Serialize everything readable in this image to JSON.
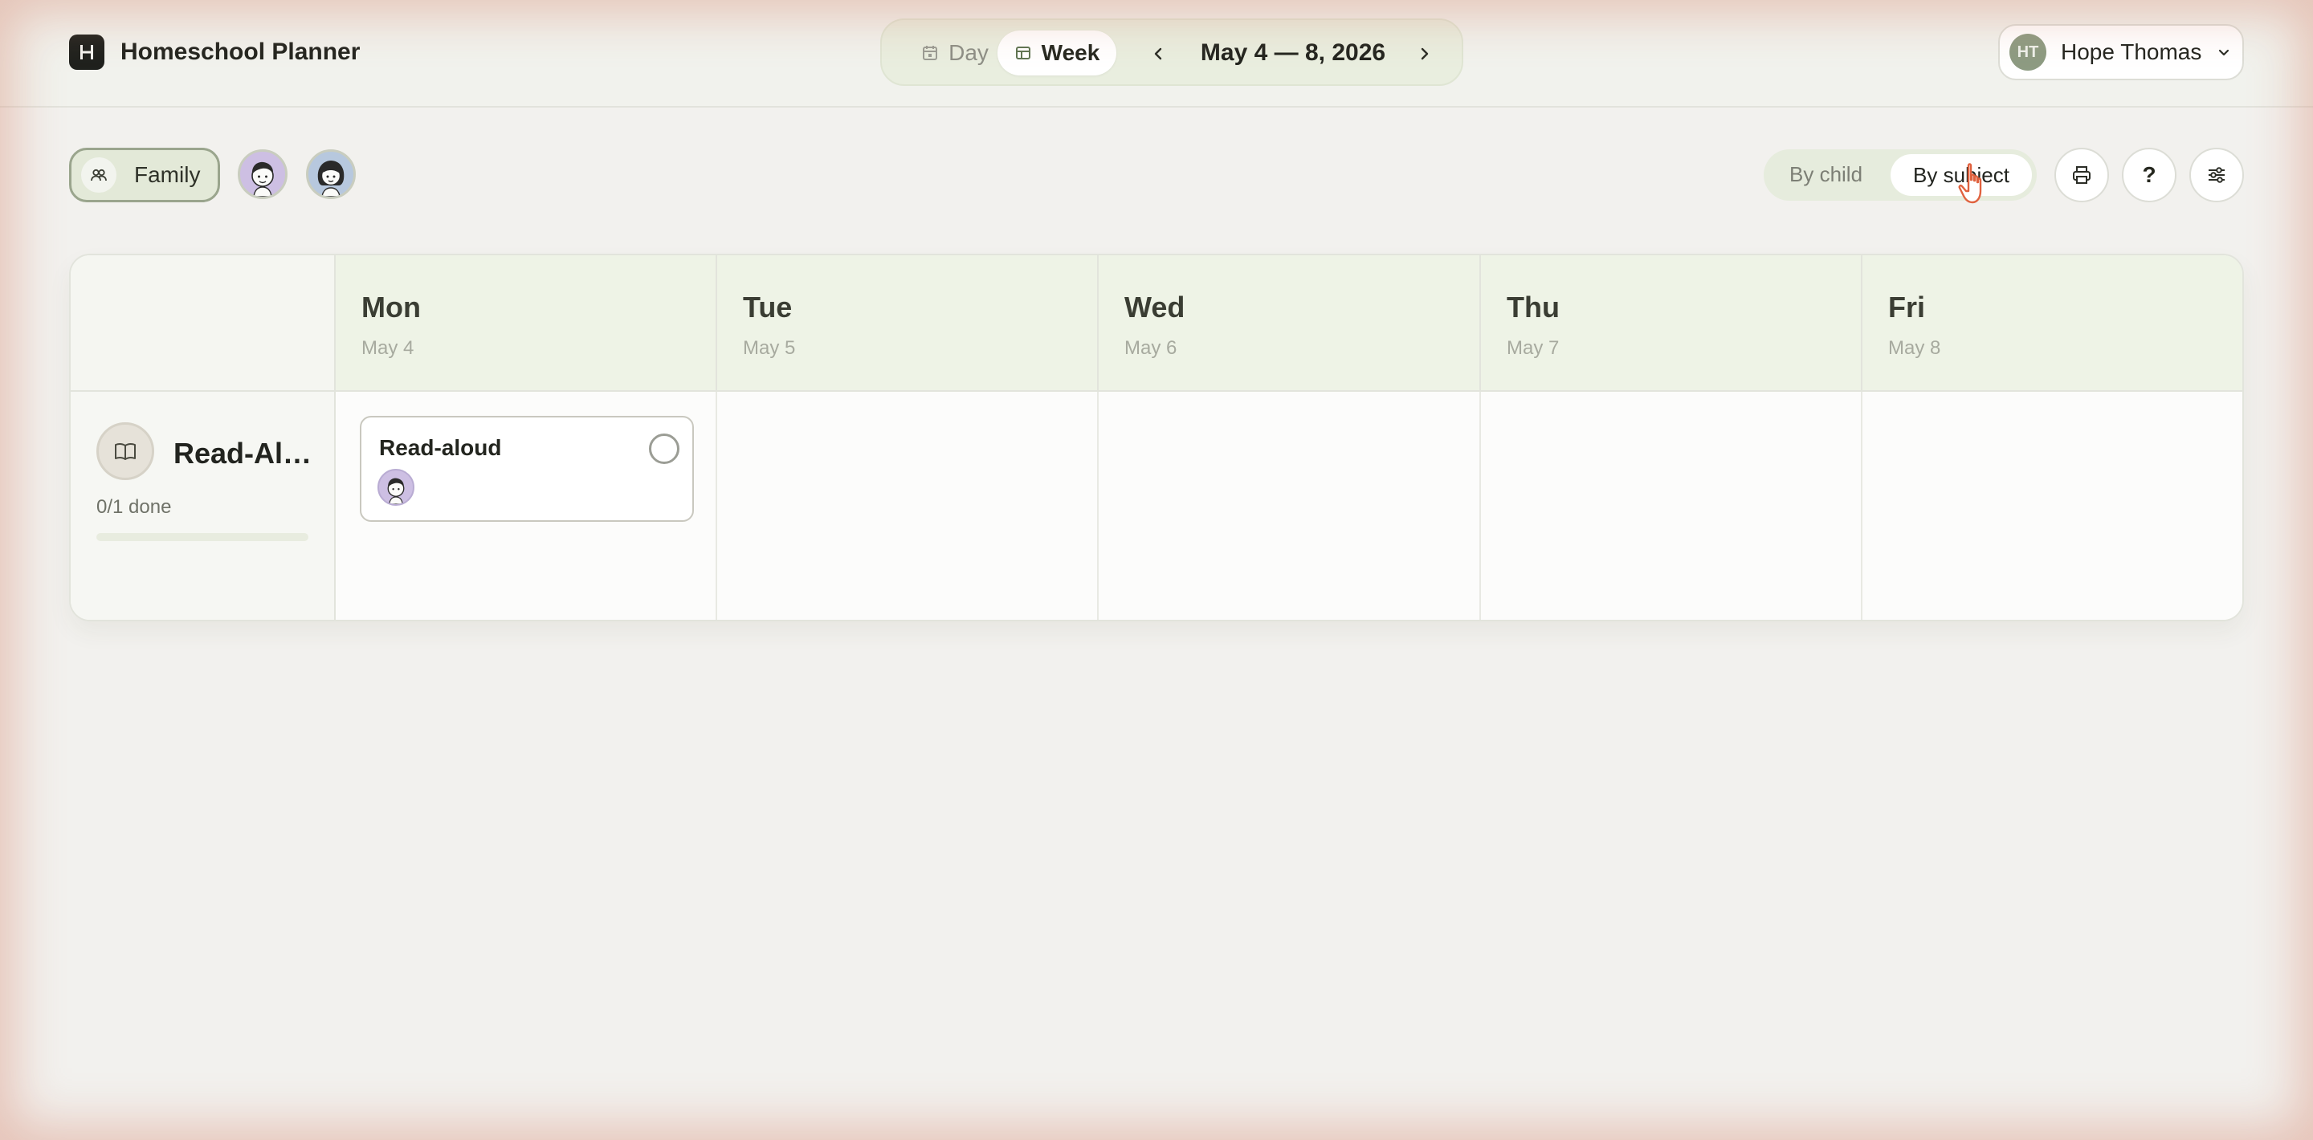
{
  "app": {
    "title": "Homeschool Planner",
    "logo_letter": "H"
  },
  "view_switch": {
    "day_label": "Day",
    "week_label": "Week",
    "active": "Week"
  },
  "date_nav": {
    "range": "May 4 — 8, 2026"
  },
  "user": {
    "initials": "HT",
    "name": "Hope Thomas"
  },
  "filters": {
    "family_label": "Family",
    "children": [
      {
        "avatar": "child-avatar-1",
        "color": "#cdbfe3"
      },
      {
        "avatar": "child-avatar-2",
        "color": "#b7c8de"
      }
    ]
  },
  "group_toggle": {
    "by_child_label": "By child",
    "by_subject_label": "By subject",
    "active": "By subject"
  },
  "toolbar": {
    "help_label": "?"
  },
  "calendar": {
    "days": [
      {
        "name": "Mon",
        "date": "May 4"
      },
      {
        "name": "Tue",
        "date": "May 5"
      },
      {
        "name": "Wed",
        "date": "May 6"
      },
      {
        "name": "Thu",
        "date": "May 7"
      },
      {
        "name": "Fri",
        "date": "May 8"
      }
    ],
    "rows": [
      {
        "subject": "Read-Aloud",
        "subject_display": "Read-Al…",
        "icon": "book-icon",
        "progress_text": "0/1 done",
        "progress_fraction": 0,
        "tasks": [
          {
            "day": "Mon",
            "title": "Read-aloud",
            "done": false,
            "assignee_avatar": "child-avatar-1"
          }
        ]
      }
    ]
  },
  "colors": {
    "accent": "#8d9b82",
    "header_bg": "#eef3e6",
    "page_bg": "#f2f1ee"
  }
}
